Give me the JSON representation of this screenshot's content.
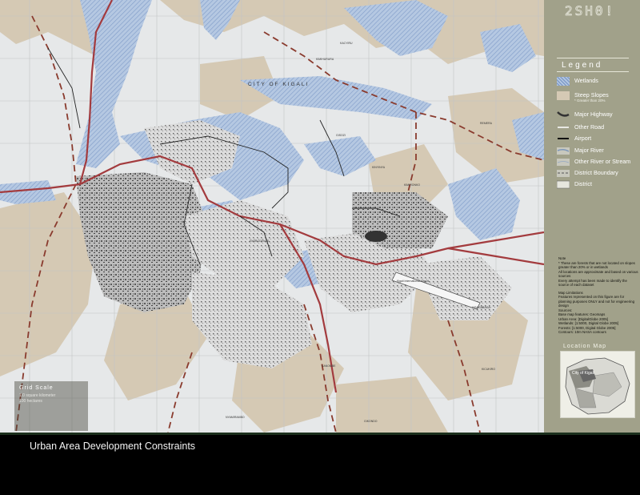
{
  "map": {
    "city_label": "CITY OF KIGALI",
    "airport_label": "Kigali International Airport",
    "place_labels": [
      "KIMIHURURA",
      "KACYIRU",
      "REMERA",
      "KIBAGABAGA",
      "KIMIRONKO",
      "NYAMIRAMBO",
      "GIKONDO",
      "KICUKIRO",
      "KANOMBE",
      "NYARUGENGE",
      "GISOZI",
      "KINYINYA"
    ],
    "grid_scale": {
      "title": "Grid Scale",
      "line1": "1.0 square kilometer",
      "line2": "100 hectares"
    },
    "colors": {
      "terrain": "#e7e9ea",
      "steep_slopes": "#d4c9b5",
      "wetlands": "#a8bfdc",
      "highway": "#a33b3e",
      "district_boundary": "#8a3b2e"
    }
  },
  "sidebar": {
    "logo": "2SH0!",
    "legend_title": "Legend",
    "legend_items": [
      {
        "label": "Wetlands",
        "sub": "",
        "swatch": "wetlands-hatch"
      },
      {
        "label": "Steep Slopes",
        "sub": "* Greater than 20%",
        "swatch": "steep-slopes-fill"
      },
      {
        "label": "Major Highway",
        "sub": "",
        "swatch": "major-highway-line"
      },
      {
        "label": "Other Road",
        "sub": "",
        "swatch": "other-road-line"
      },
      {
        "label": "Airport",
        "sub": "",
        "swatch": "airport-line"
      },
      {
        "label": "Major River",
        "sub": "",
        "swatch": "major-river-line"
      },
      {
        "label": "Other River or Stream",
        "sub": "",
        "swatch": "stream-line"
      },
      {
        "label": "District Boundary",
        "sub": "",
        "swatch": "district-boundary-line"
      },
      {
        "label": "District",
        "sub": "",
        "swatch": "district-fill"
      }
    ],
    "notes": {
      "heading": "Note",
      "lines": [
        "* These are forests that are not located on slopes greater than 20% or in wetlands",
        "All locations are approximate and based on various sources",
        "Every attempt has been made to identify the source of each dataset"
      ]
    },
    "limitations": {
      "heading": "Map Limitations",
      "lines": [
        "Features represented on this figure are for planning purposes ONLY and not for engineering design",
        "Sources:",
        "Base map features: Geomaps",
        "Urban Area: [DigitalGlobe 2005]",
        "Wetlands: [1:5000, Digital Globe 2005]",
        "Forests: [1:5000, Digital Globe 2005]",
        "Contours: 10m NASA contours"
      ]
    },
    "location_map_title": "Location Map",
    "location_map_label": "City of Kigali"
  },
  "footer": {
    "title": "Urban Area Development Constraints"
  }
}
